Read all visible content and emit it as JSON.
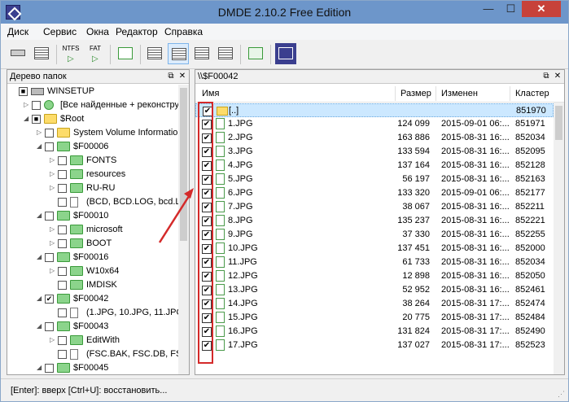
{
  "window": {
    "title": "DMDE 2.10.2 Free Edition",
    "min_glyph": "—",
    "max_glyph": "☐",
    "close_glyph": "✕"
  },
  "menu": [
    "Диск",
    "Сервис",
    "Окна",
    "Редактор",
    "Справка"
  ],
  "toolbar": {
    "ntfs_label": "NTFS",
    "fat_label": "FAT",
    "play_glyph": "▷"
  },
  "tree_pane": {
    "title": "Дерево папок",
    "pin_glyph": "⧉",
    "close_glyph": "✕",
    "rows": [
      {
        "text": "WINSETUP",
        "icon": "drive-icon",
        "check": "■",
        "expand": ""
      },
      {
        "text": "[Все найденные + реконстру",
        "icon": "recycle-icon",
        "check": "",
        "expand": "▷"
      },
      {
        "text": "$Root",
        "icon": "folder-icon",
        "check": "■",
        "expand": "◢"
      },
      {
        "text": "System Volume Information",
        "icon": "folder-icon",
        "check": "",
        "expand": "▷"
      },
      {
        "text": "$F00006",
        "icon": "folder-green-icon",
        "check": "",
        "expand": "◢"
      },
      {
        "text": "FONTS",
        "icon": "folder-green-icon",
        "check": "",
        "expand": "▷"
      },
      {
        "text": "resources",
        "icon": "folder-green-icon",
        "check": "",
        "expand": "▷"
      },
      {
        "text": "RU-RU",
        "icon": "folder-green-icon",
        "check": "",
        "expand": "▷"
      },
      {
        "text": "(BCD, BCD.LOG, bcd.LOG1",
        "icon": "files-icon",
        "check": "",
        "expand": ""
      },
      {
        "text": "$F00010",
        "icon": "folder-green-icon",
        "check": "",
        "expand": "◢"
      },
      {
        "text": "microsoft",
        "icon": "folder-green-icon",
        "check": "",
        "expand": "▷"
      },
      {
        "text": "BOOT",
        "icon": "folder-green-icon",
        "check": "",
        "expand": "▷"
      },
      {
        "text": "$F00016",
        "icon": "folder-green-icon",
        "check": "",
        "expand": "◢"
      },
      {
        "text": "W10x64",
        "icon": "folder-green-icon",
        "check": "",
        "expand": "▷"
      },
      {
        "text": "IMDISK",
        "icon": "folder-green-icon",
        "check": "",
        "expand": ""
      },
      {
        "text": "$F00042",
        "icon": "folder-green-icon",
        "check": "✔",
        "expand": "◢"
      },
      {
        "text": "(1.JPG, 10.JPG, 11.JPG, 12.JF",
        "icon": "files-icon",
        "check": "",
        "expand": ""
      },
      {
        "text": "$F00043",
        "icon": "folder-green-icon",
        "check": "",
        "expand": "◢"
      },
      {
        "text": "EditWith",
        "icon": "folder-green-icon",
        "check": "",
        "expand": "▷"
      },
      {
        "text": "(FSC.BAK, FSC.DB, FSCaptu",
        "icon": "files-icon",
        "check": "",
        "expand": ""
      },
      {
        "text": "$F00045",
        "icon": "folder-green-icon",
        "check": "",
        "expand": "◢"
      }
    ]
  },
  "file_pane": {
    "path": "\\\\$F00042",
    "pin_glyph": "⧉",
    "close_glyph": "✕",
    "columns": {
      "name": "Имя",
      "size": "Размер",
      "modified": "Изменен",
      "cluster": "Кластер"
    },
    "rows": [
      {
        "name": "[..]",
        "size": "",
        "modified": "",
        "cluster": "851970",
        "up": true
      },
      {
        "name": "1.JPG",
        "size": "124 099",
        "modified": "2015-09-01 06:...",
        "cluster": "851971"
      },
      {
        "name": "2.JPG",
        "size": "163 886",
        "modified": "2015-08-31 16:...",
        "cluster": "852034"
      },
      {
        "name": "3.JPG",
        "size": "133 594",
        "modified": "2015-08-31 16:...",
        "cluster": "852095"
      },
      {
        "name": "4.JPG",
        "size": "137 164",
        "modified": "2015-08-31 16:...",
        "cluster": "852128"
      },
      {
        "name": "5.JPG",
        "size": "56 197",
        "modified": "2015-08-31 16:...",
        "cluster": "852163"
      },
      {
        "name": "6.JPG",
        "size": "133 320",
        "modified": "2015-09-01 06:...",
        "cluster": "852177"
      },
      {
        "name": "7.JPG",
        "size": "38 067",
        "modified": "2015-08-31 16:...",
        "cluster": "852211"
      },
      {
        "name": "8.JPG",
        "size": "135 237",
        "modified": "2015-08-31 16:...",
        "cluster": "852221"
      },
      {
        "name": "9.JPG",
        "size": "37 330",
        "modified": "2015-08-31 16:...",
        "cluster": "852255"
      },
      {
        "name": "10.JPG",
        "size": "137 451",
        "modified": "2015-08-31 16:...",
        "cluster": "852000"
      },
      {
        "name": "11.JPG",
        "size": "61 733",
        "modified": "2015-08-31 16:...",
        "cluster": "852034"
      },
      {
        "name": "12.JPG",
        "size": "12 898",
        "modified": "2015-08-31 16:...",
        "cluster": "852050"
      },
      {
        "name": "13.JPG",
        "size": "52 952",
        "modified": "2015-08-31 16:...",
        "cluster": "852461"
      },
      {
        "name": "14.JPG",
        "size": "38 264",
        "modified": "2015-08-31 17:...",
        "cluster": "852474"
      },
      {
        "name": "15.JPG",
        "size": "20 775",
        "modified": "2015-08-31 17:...",
        "cluster": "852484"
      },
      {
        "name": "16.JPG",
        "size": "131 824",
        "modified": "2015-08-31 17:...",
        "cluster": "852490"
      },
      {
        "name": "17.JPG",
        "size": "137 027",
        "modified": "2015-08-31 17:...",
        "cluster": "852523"
      }
    ]
  },
  "status": {
    "text": "[Enter]: вверх  [Ctrl+U]: восстановить...",
    "grip_glyph": "⋰"
  },
  "colors": {
    "titlebar": "#6d96ca",
    "close_button": "#c7423a",
    "selection": "#cce8ff",
    "annotation": "#d42a2a"
  }
}
